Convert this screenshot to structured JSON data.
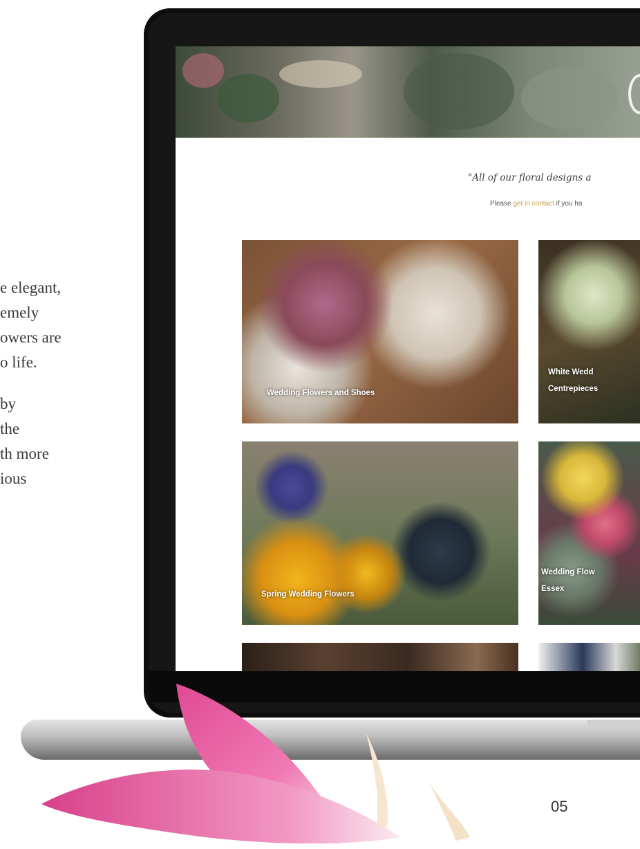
{
  "side_text": {
    "paragraph_1": [
      "e elegant,",
      "emely",
      "owers are",
      "o life."
    ],
    "paragraph_2": [
      "by",
      "the",
      "th more",
      "ious"
    ]
  },
  "screen": {
    "quote": "\"All of our floral designs a",
    "contact": {
      "prefix": "Please ",
      "link": "get in contact",
      "suffix": " if you ha"
    },
    "tiles": [
      {
        "caption_lines": [
          "Wedding Flowers and Shoes"
        ]
      },
      {
        "caption_lines": [
          "White Wedd",
          "Centrepieces"
        ]
      },
      {
        "caption_lines": [
          "Spring Wedding Flowers"
        ]
      },
      {
        "caption_lines": [
          "Wedding Flow",
          "Essex"
        ]
      }
    ]
  },
  "page_number": "05",
  "colors": {
    "link": "#c9a24a",
    "text": "#3a3a3a",
    "petal": "#e4569a"
  }
}
